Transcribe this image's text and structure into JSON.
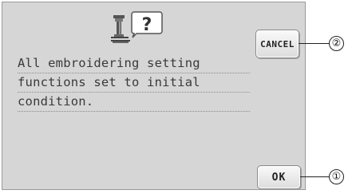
{
  "dialog": {
    "message_lines": [
      "All embroidering setting",
      "functions set to initial",
      "condition."
    ],
    "header_icon": "machine-question-icon"
  },
  "buttons": {
    "cancel_label": "CANCEL",
    "ok_label": "OK"
  },
  "callouts": {
    "cancel_number": "②",
    "ok_number": "①"
  }
}
